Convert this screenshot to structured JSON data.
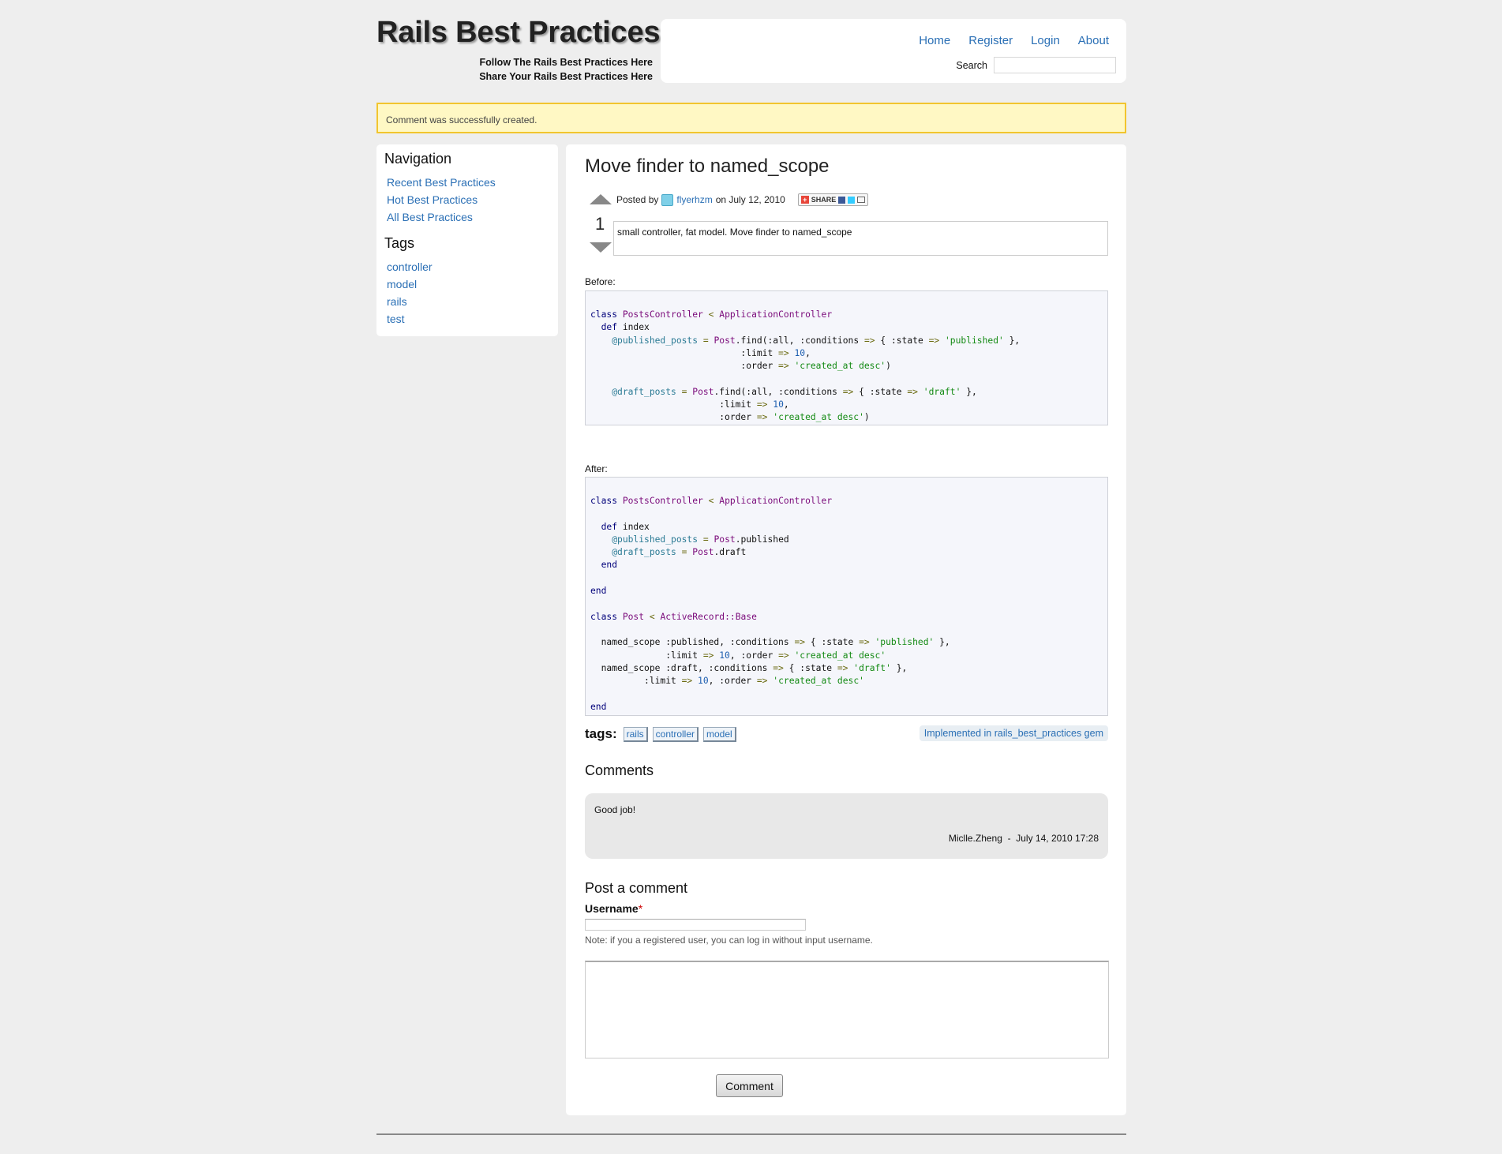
{
  "header": {
    "site_title": "Rails Best Practices",
    "tagline_1": "Follow The Rails Best Practices Here",
    "tagline_2": "Share Your Rails Best Practices Here",
    "nav": [
      "Home",
      "Register",
      "Login",
      "About"
    ],
    "search_label": "Search",
    "search_value": ""
  },
  "flash": "Comment was successfully created.",
  "sidebar": {
    "navigation_heading": "Navigation",
    "navigation": [
      "Recent Best Practices",
      "Hot Best Practices",
      "All Best Practices"
    ],
    "tags_heading": "Tags",
    "tags": [
      "controller",
      "model",
      "rails",
      "test"
    ]
  },
  "post": {
    "title": "Move finder to named_scope",
    "vote_count": "1",
    "posted_by_prefix": "Posted by",
    "author": "flyerhzm",
    "posted_on": "on July 12, 2010",
    "share_label": "SHARE",
    "summary": "small controller, fat model. Move finder to named_scope",
    "before_label": "Before:",
    "after_label": "After:",
    "tags_label": "tags:",
    "tags": [
      "rails",
      "controller",
      "model"
    ],
    "implemented": "Implemented in rails_best_practices gem"
  },
  "comments": {
    "heading": "Comments",
    "items": [
      {
        "body": "Good job!",
        "author": "Miclle.Zheng",
        "separator": "-",
        "date": "July 14, 2010 17:28"
      }
    ]
  },
  "comment_form": {
    "heading": "Post a comment",
    "username_label": "Username",
    "required_mark": "*",
    "username_value": "",
    "note": "Note: if you a registered user, you can log in without input username.",
    "body_value": "",
    "submit_label": "Comment"
  },
  "colors": {
    "link": "#2a6fb5",
    "flash_bg": "#fff8c4",
    "flash_border": "#f2c52e",
    "code_bg": "#f5f6fb"
  }
}
